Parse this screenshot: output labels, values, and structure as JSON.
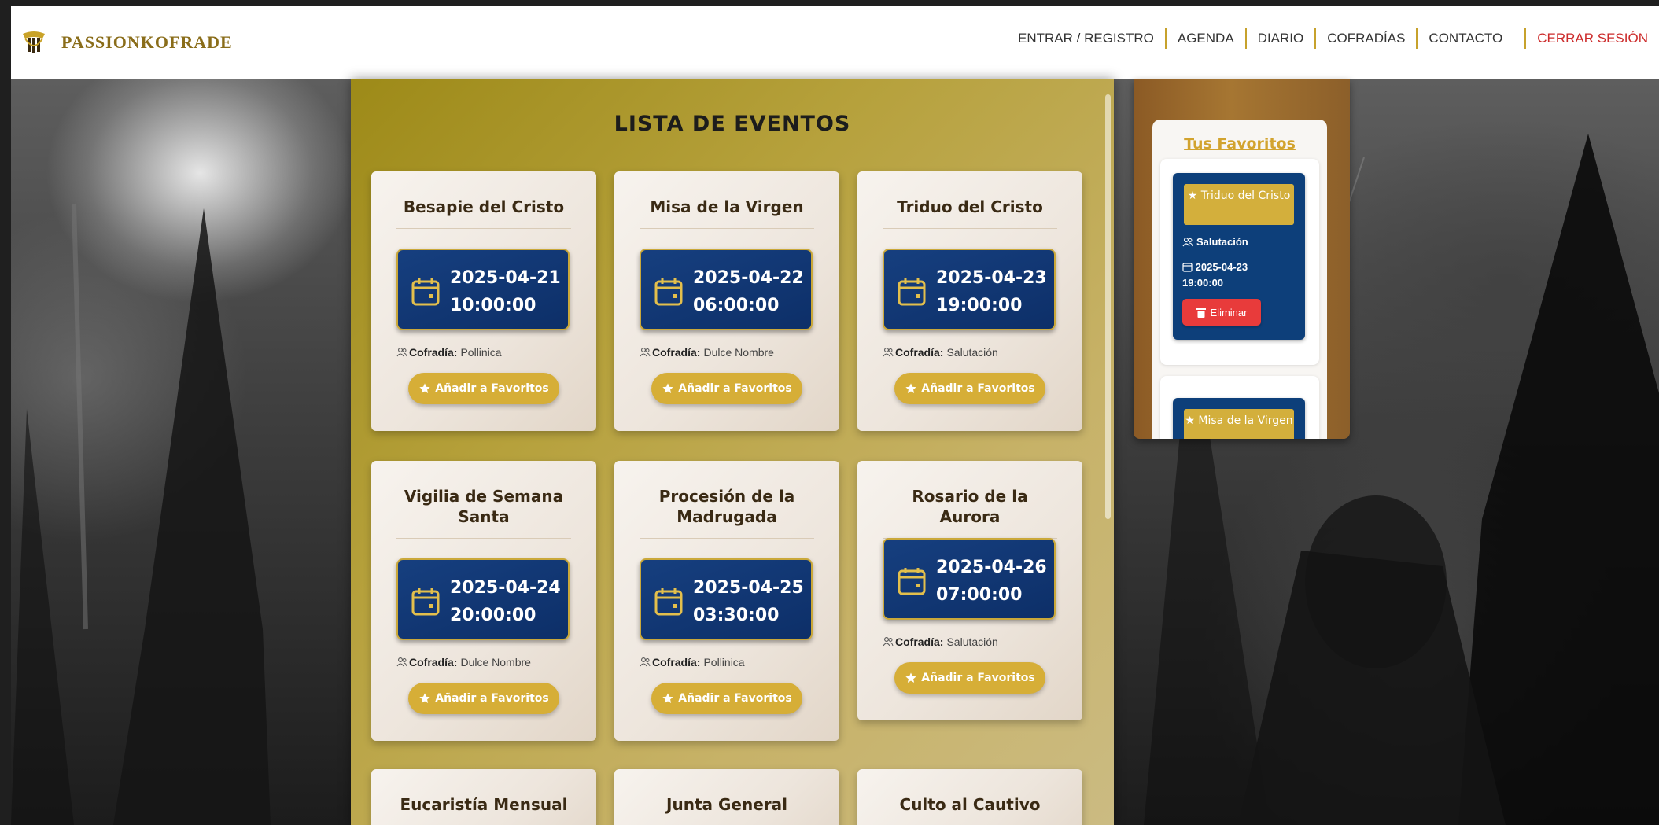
{
  "header": {
    "brand": "PASSIONKOFRADE",
    "nav": [
      {
        "label": "ENTRAR / REGISTRO"
      },
      {
        "label": "AGENDA"
      },
      {
        "label": "DIARIO"
      },
      {
        "label": "COFRADÍAS"
      },
      {
        "label": "CONTACTO"
      }
    ],
    "logout": "CERRAR SESIÓN"
  },
  "main": {
    "title": "LISTA DE EVENTOS",
    "cofradia_label": "Cofradía:",
    "fav_button_label": "Añadir a Favoritos",
    "events": [
      {
        "title": "Besapie del Cristo",
        "date": "2025-04-21",
        "time": "10:00:00",
        "cofradia": "Pollinica"
      },
      {
        "title": "Misa de la Virgen",
        "date": "2025-04-22",
        "time": "06:00:00",
        "cofradia": "Dulce Nombre"
      },
      {
        "title": "Triduo del Cristo",
        "date": "2025-04-23",
        "time": "19:00:00",
        "cofradia": "Salutación"
      },
      {
        "title": "Vigilia de Semana Santa",
        "date": "2025-04-24",
        "time": "20:00:00",
        "cofradia": "Dulce Nombre"
      },
      {
        "title": "Procesión de la Madrugada",
        "date": "2025-04-25",
        "time": "03:30:00",
        "cofradia": "Pollinica"
      },
      {
        "title": "Rosario de la Aurora",
        "date": "2025-04-26",
        "time": "07:00:00",
        "cofradia": "Salutación"
      },
      {
        "title": "Eucaristía Mensual"
      },
      {
        "title": "Junta General"
      },
      {
        "title": "Culto al Cautivo"
      }
    ]
  },
  "favorites": {
    "heading": "Tus Favoritos",
    "delete_label": "Eliminar",
    "items": [
      {
        "title": "Triduo del Cristo",
        "cofradia": "Salutación",
        "date": "2025-04-23",
        "time": "19:00:00"
      },
      {
        "title": "Misa de la Virgen"
      }
    ]
  },
  "colors": {
    "gold": "#d6ae37",
    "navy": "#0d3f7a",
    "danger": "#e83b3b",
    "brand": "#8a6d1a"
  },
  "icons": [
    "brand-logo-icon",
    "calendar-icon",
    "people-icon",
    "star-icon",
    "trash-icon"
  ]
}
